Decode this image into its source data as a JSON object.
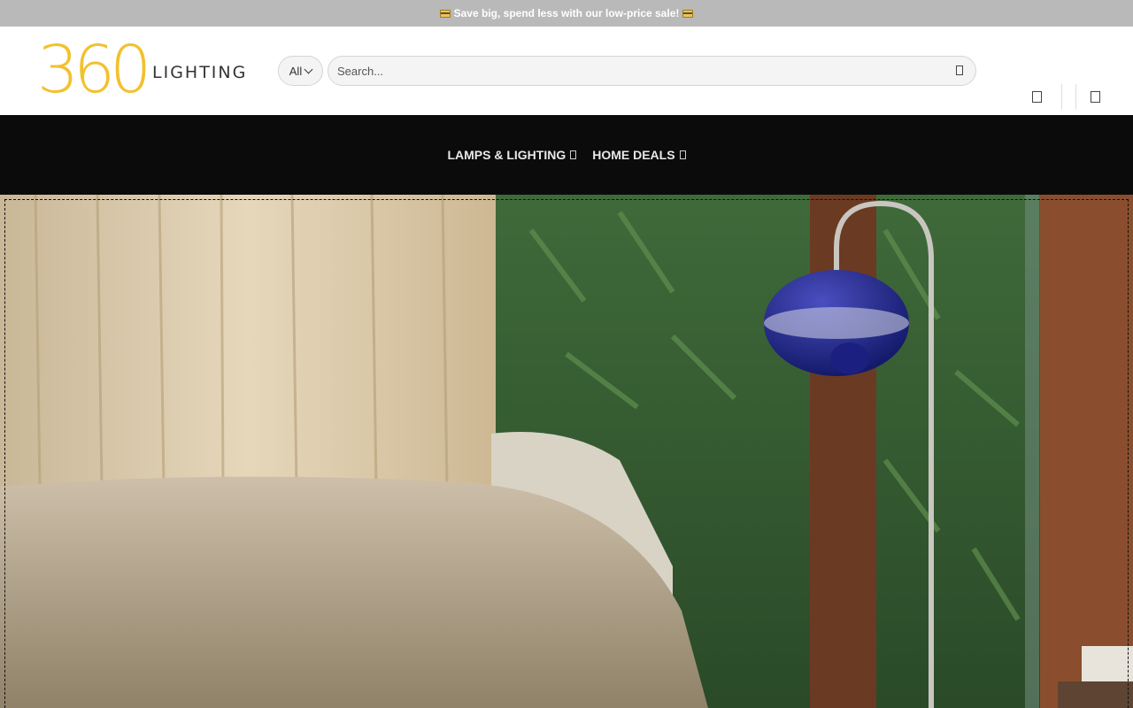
{
  "announcement": {
    "text": "Save big, spend less with our low-price sale!",
    "icon": "credit-card-emoji"
  },
  "logo": {
    "number": "360",
    "word": "LIGHTING",
    "color": "#f2c12e"
  },
  "search": {
    "category": "All",
    "placeholder": "Search..."
  },
  "nav": {
    "items": [
      {
        "label": "LAMPS & LIGHTING"
      },
      {
        "label": "HOME DEALS"
      }
    ]
  },
  "header_icons": [
    "account-icon",
    "cart-icon"
  ],
  "colors": {
    "announce_bg": "#b9b9b9",
    "nav_bg": "#0b0b0b",
    "accent": "#f2c12e"
  },
  "hero": {
    "image": "living-room-floor-lamp-photo"
  }
}
